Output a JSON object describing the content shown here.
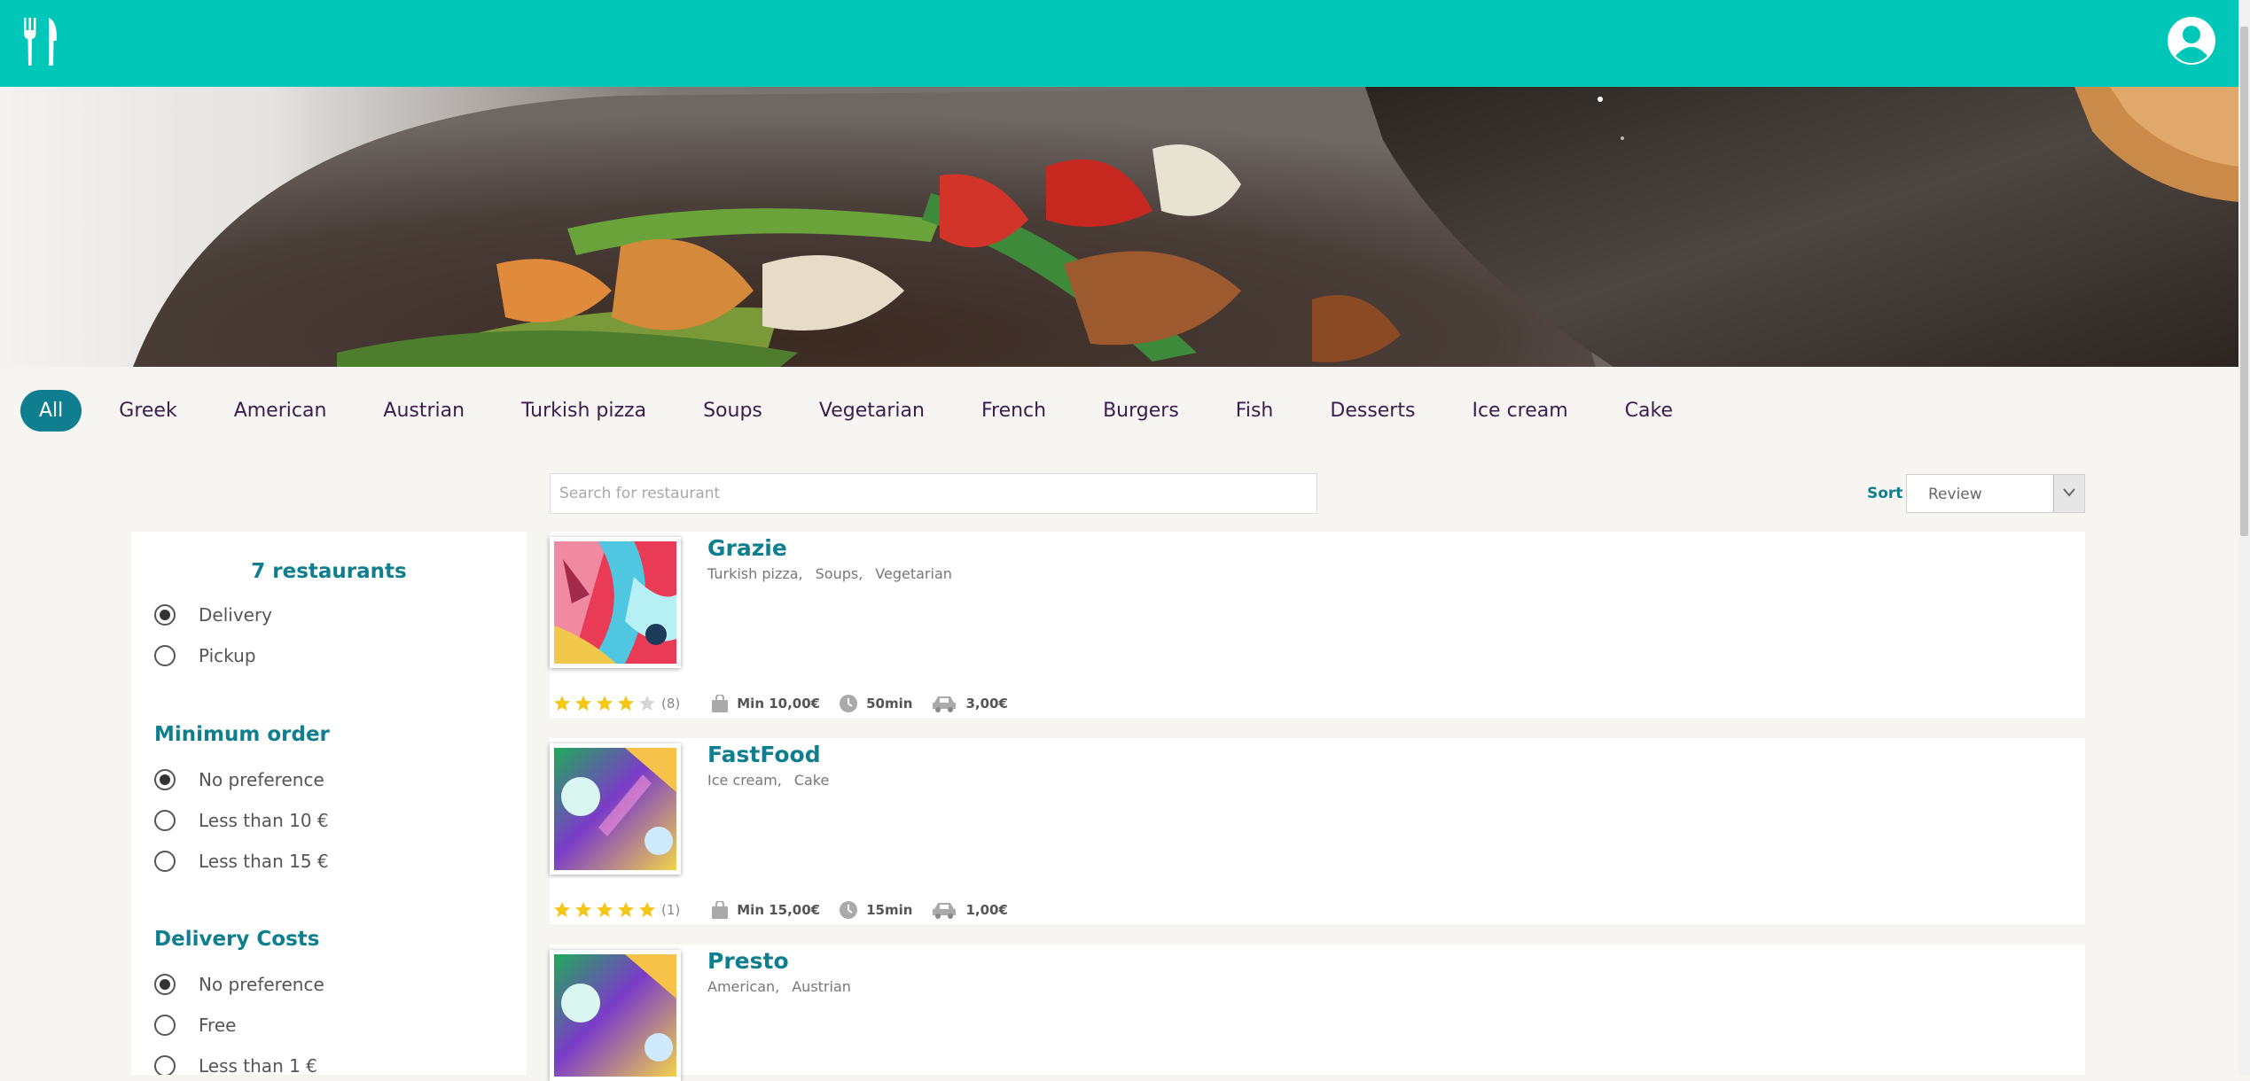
{
  "header": {
    "logo_icon": "fork-knife-icon",
    "profile_icon": "user-avatar-icon"
  },
  "categories": [
    "All",
    "Greek",
    "American",
    "Austrian",
    "Turkish pizza",
    "Soups",
    "Vegetarian",
    "French",
    "Burgers",
    "Fish",
    "Desserts",
    "Ice cream",
    "Cake"
  ],
  "selected_category": "All",
  "search": {
    "placeholder": "Search for restaurant",
    "value": ""
  },
  "sort": {
    "label": "Sort",
    "value": "Review"
  },
  "filters": {
    "count": "7 restaurants",
    "service": [
      {
        "label": "Delivery",
        "checked": true
      },
      {
        "label": "Pickup",
        "checked": false
      }
    ],
    "min_order": {
      "title": "Minimum order",
      "options": [
        {
          "label": "No preference",
          "checked": true
        },
        {
          "label": "Less than 10 €",
          "checked": false
        },
        {
          "label": "Less than 15 €",
          "checked": false
        }
      ]
    },
    "delivery_costs": {
      "title": "Delivery Costs",
      "options": [
        {
          "label": "No preference",
          "checked": true
        },
        {
          "label": "Free",
          "checked": false
        },
        {
          "label": "Less than 1 €",
          "checked": false
        }
      ]
    }
  },
  "restaurants": [
    {
      "name": "Grazie",
      "tags": [
        "Turkish pizza,",
        "Soups,",
        "Vegetarian"
      ],
      "rating": 4,
      "reviews": "(8)",
      "min_order": "Min 10,00€",
      "time": "50min",
      "delivery": "3,00€"
    },
    {
      "name": "FastFood",
      "tags": [
        "Ice cream,",
        "Cake"
      ],
      "rating": 5,
      "reviews": "(1)",
      "min_order": "Min 15,00€",
      "time": "15min",
      "delivery": "1,00€"
    },
    {
      "name": "Presto",
      "tags": [
        "American,",
        "Austrian"
      ]
    }
  ],
  "colors": {
    "brand": "#00c7b8",
    "accent": "#0f7f8f",
    "category_text": "#3b1d4d",
    "star": "#f5c518"
  }
}
